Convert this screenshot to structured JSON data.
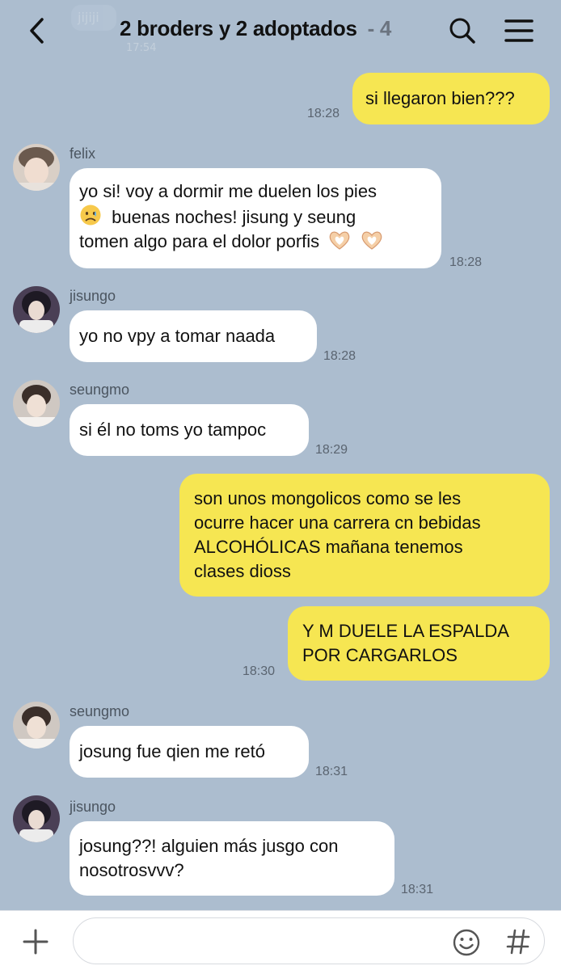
{
  "header": {
    "title": "2 broders y 2 adoptados",
    "separator": "-",
    "member_count": "4",
    "back_icon": "chevron-left-icon",
    "search_icon": "search-icon",
    "menu_icon": "hamburger-menu-icon",
    "ghost_message": "jijiji",
    "ghost_time": "17:54"
  },
  "messages": [
    {
      "from": "me",
      "text": "si llegaron bien???",
      "time": "18:28"
    },
    {
      "from": "felix",
      "sender": "felix",
      "text_line1": "yo si! voy a dormir me duelen los pies",
      "text_line2": "buenas noches! jisung y seung",
      "text_line3": "tomen algo para el dolor porfis",
      "emojis": [
        "sad-face-emoji",
        "heart-hands-emoji",
        "heart-hands-emoji"
      ],
      "time": "18:28"
    },
    {
      "from": "jisungo",
      "sender": "jisungo",
      "text": "yo no vpy a tomar naada",
      "time": "18:28"
    },
    {
      "from": "seungmo",
      "sender": "seungmo",
      "text": "si él no toms yo tampoc",
      "time": "18:29"
    },
    {
      "from": "me",
      "text_lines": [
        "son unos mongolicos como se les",
        "ocurre hacer una carrera cn bebidas",
        "ALCOHÓLICAS mañana tenemos",
        "clases dioss"
      ]
    },
    {
      "from": "me",
      "text_lines": [
        "Y M DUELE LA ESPALDA",
        "POR CARGARLOS"
      ],
      "time": "18:30"
    },
    {
      "from": "seungmo",
      "sender": "seungmo",
      "text": "josung fue qien me retó",
      "time": "18:31"
    },
    {
      "from": "jisungo",
      "sender": "jisungo",
      "text_lines": [
        "josung??! alguien más jusgo con",
        "nosotrosvvv?"
      ],
      "time": "18:31"
    }
  ],
  "footer": {
    "plus_icon": "plus-icon",
    "input_value": "",
    "input_placeholder": "",
    "emoji_icon": "smiley-icon",
    "hashtag_icon": "hashtag-icon"
  },
  "colors": {
    "background": "#acbdcf",
    "my_bubble": "#f6e652",
    "their_bubble": "#ffffff",
    "timestamp": "#5a6470"
  }
}
